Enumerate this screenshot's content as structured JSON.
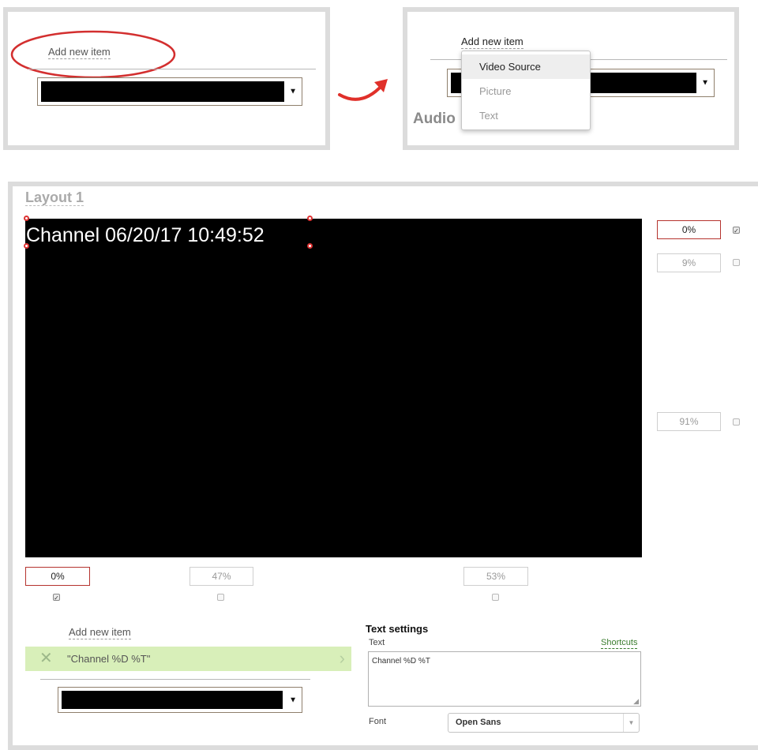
{
  "step1": {
    "add_item_label": "Add new item"
  },
  "step2": {
    "add_item_label": "Add new item",
    "behind_heading": "Audio",
    "menu_items": [
      "Video Source",
      "Picture",
      "Text"
    ]
  },
  "layout": {
    "title": "Layout 1",
    "overlay_text": "Channel 06/20/17 10:49:52",
    "right_positions": [
      "0%",
      "9%",
      "91%"
    ],
    "bottom_positions": [
      "0%",
      "47%",
      "53%"
    ]
  },
  "items_panel": {
    "add_item_label": "Add new item",
    "items": [
      "\"Channel %D %T\""
    ]
  },
  "text_settings": {
    "heading": "Text settings",
    "text_label": "Text",
    "shortcuts_link": "Shortcuts",
    "text_value": "Channel %D %T",
    "font_label": "Font",
    "font_value": "Open Sans"
  },
  "colors": {
    "highlight_circle": "#d32f2f",
    "selected_item_bg": "#d8efb9",
    "active_border": "#b5332e"
  }
}
